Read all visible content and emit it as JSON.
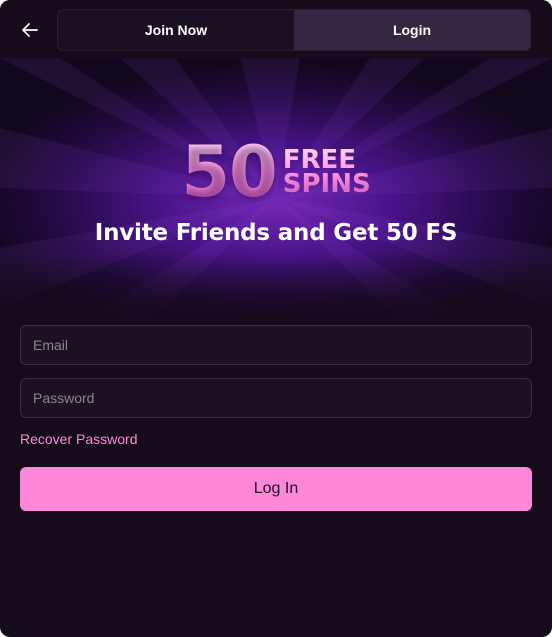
{
  "header": {
    "tabs": [
      {
        "label": "Join Now",
        "active": false
      },
      {
        "label": "Login",
        "active": true
      }
    ]
  },
  "banner": {
    "number": "50",
    "words": [
      "FREE",
      "SPINS"
    ],
    "headline": "Invite Friends and Get 50 FS"
  },
  "form": {
    "email_placeholder": "Email",
    "password_placeholder": "Password",
    "recover_label": "Recover Password",
    "submit_label": "Log In"
  },
  "colors": {
    "background": "#150b1b",
    "accent": "#ff87d9",
    "tab_active": "#342541"
  },
  "icons": {
    "back": "arrow-left-icon"
  }
}
